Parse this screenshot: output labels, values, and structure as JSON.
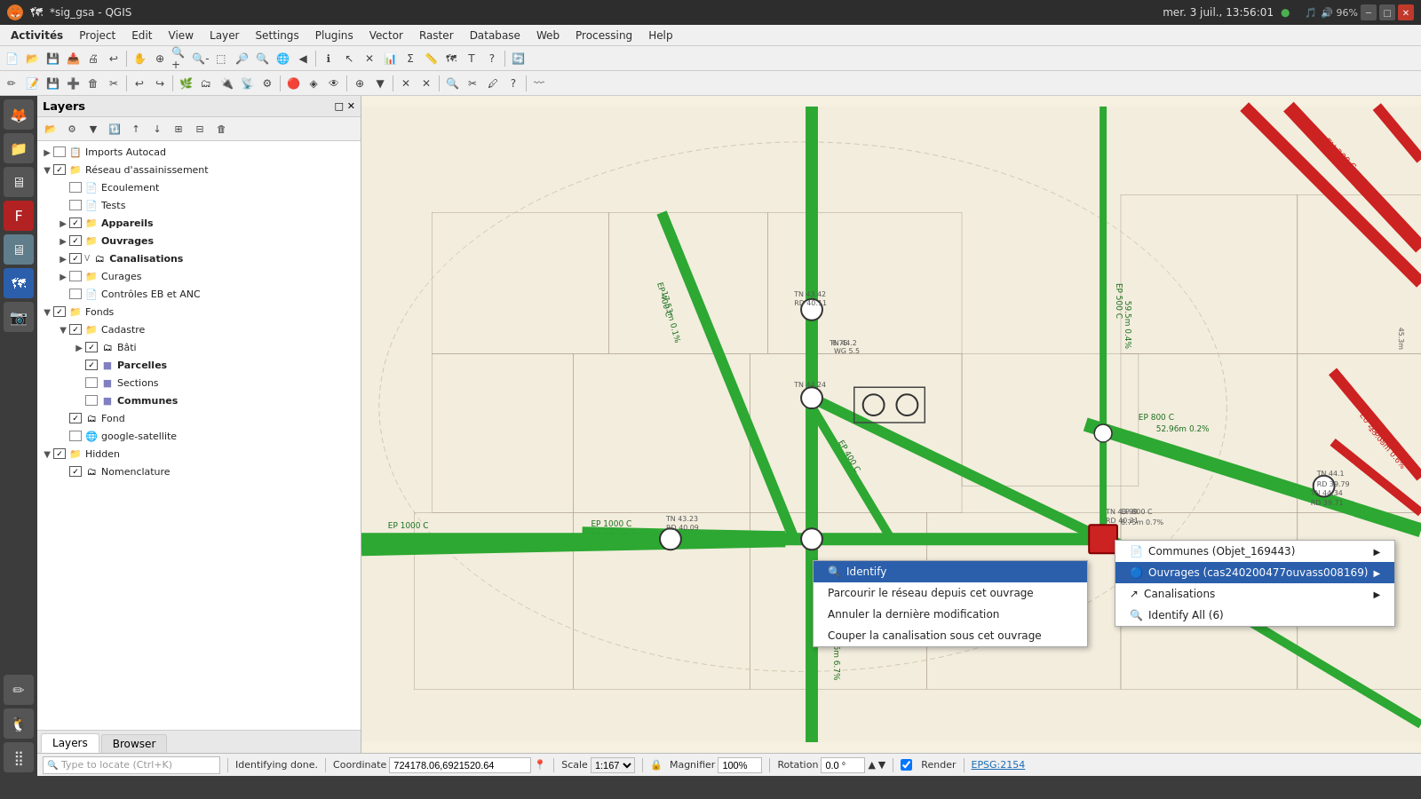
{
  "titlebar": {
    "title": "*sig_gsa - QGIS",
    "datetime": "mer. 3 juil., 13:56:01",
    "dot_indicator": "●",
    "wm_min": "─",
    "wm_max": "□",
    "wm_close": "✕"
  },
  "menubar": {
    "items": [
      "Activités",
      "Project",
      "Edit",
      "View",
      "Layer",
      "Settings",
      "Plugins",
      "Vector",
      "Raster",
      "Database",
      "Web",
      "Processing",
      "Help"
    ]
  },
  "layers_panel": {
    "title": "Layers",
    "tree": [
      {
        "id": "imports-autocad",
        "label": "Imports Autocad",
        "indent": 0,
        "checked": false,
        "has_arrow": true,
        "icon": "📋",
        "bold": false
      },
      {
        "id": "reseau-assainissement",
        "label": "Réseau d'assainissement",
        "indent": 0,
        "checked": true,
        "has_arrow": true,
        "icon": "📁",
        "bold": false
      },
      {
        "id": "ecoulement",
        "label": "Ecoulement",
        "indent": 1,
        "checked": false,
        "has_arrow": false,
        "icon": "📄",
        "bold": false
      },
      {
        "id": "tests",
        "label": "Tests",
        "indent": 1,
        "checked": false,
        "has_arrow": false,
        "icon": "📄",
        "bold": false
      },
      {
        "id": "appareils",
        "label": "Appareils",
        "indent": 1,
        "checked": true,
        "has_arrow": true,
        "icon": "📁",
        "bold": true
      },
      {
        "id": "ouvrages",
        "label": "Ouvrages",
        "indent": 1,
        "checked": true,
        "has_arrow": true,
        "icon": "📁",
        "bold": true
      },
      {
        "id": "canalisations",
        "label": "Canalisations",
        "indent": 1,
        "checked": true,
        "has_arrow": true,
        "icon": "🗂",
        "bold": true
      },
      {
        "id": "curages",
        "label": "Curages",
        "indent": 1,
        "checked": false,
        "has_arrow": true,
        "icon": "📁",
        "bold": false
      },
      {
        "id": "controles-eb-anc",
        "label": "Contrôles EB et ANC",
        "indent": 1,
        "checked": false,
        "has_arrow": false,
        "icon": "📄",
        "bold": false
      },
      {
        "id": "fonds",
        "label": "Fonds",
        "indent": 0,
        "checked": true,
        "has_arrow": true,
        "icon": "📁",
        "bold": false
      },
      {
        "id": "cadastre",
        "label": "Cadastre",
        "indent": 1,
        "checked": true,
        "has_arrow": true,
        "icon": "📁",
        "bold": false
      },
      {
        "id": "bati",
        "label": "Bâti",
        "indent": 2,
        "checked": true,
        "has_arrow": true,
        "icon": "🗂",
        "bold": false
      },
      {
        "id": "parcelles",
        "label": "Parcelles",
        "indent": 2,
        "checked": true,
        "has_arrow": false,
        "icon": "🟦",
        "bold": true
      },
      {
        "id": "sections",
        "label": "Sections",
        "indent": 2,
        "checked": false,
        "has_arrow": false,
        "icon": "🟦",
        "bold": false
      },
      {
        "id": "communes",
        "label": "Communes",
        "indent": 2,
        "checked": false,
        "has_arrow": false,
        "icon": "🟦",
        "bold": true
      },
      {
        "id": "fond",
        "label": "Fond",
        "indent": 1,
        "checked": true,
        "has_arrow": false,
        "icon": "🗂",
        "bold": false
      },
      {
        "id": "google-satellite",
        "label": "google-satellite",
        "indent": 1,
        "checked": false,
        "has_arrow": false,
        "icon": "🌐",
        "bold": false
      },
      {
        "id": "hidden",
        "label": "Hidden",
        "indent": 0,
        "checked": true,
        "has_arrow": true,
        "icon": "📁",
        "bold": false
      },
      {
        "id": "nomenclature",
        "label": "Nomenclature",
        "indent": 1,
        "checked": true,
        "has_arrow": false,
        "icon": "🗂",
        "bold": false
      }
    ]
  },
  "bottom_tabs": {
    "tabs": [
      "Layers",
      "Browser"
    ],
    "active": "Layers"
  },
  "context_menu_main": {
    "items": [
      {
        "label": "Identify",
        "icon": "🔍",
        "highlighted": true
      },
      {
        "label": "Parcourir le réseau depuis cet ouvrage",
        "icon": "",
        "highlighted": false
      },
      {
        "label": "Annuler la dernière modification",
        "icon": "",
        "highlighted": false
      },
      {
        "label": "Couper la canalisation sous cet ouvrage",
        "icon": "",
        "highlighted": false
      }
    ]
  },
  "context_menu_sub": {
    "items": [
      {
        "label": "Communes (Objet_169443)",
        "icon": "📄",
        "highlighted": false,
        "has_arrow": true
      },
      {
        "label": "Ouvrages (cas240200477ouvass008169)",
        "icon": "🔵",
        "highlighted": true,
        "has_arrow": true
      },
      {
        "label": "Canalisations",
        "icon": "↗",
        "highlighted": false,
        "has_arrow": true
      },
      {
        "label": "Identify All (6)",
        "icon": "🔍",
        "highlighted": false,
        "has_arrow": false
      }
    ]
  },
  "statusbar": {
    "status_text": "Identifying done.",
    "coordinate_label": "Coordinate",
    "coordinate_value": "724178.06,6921520.64",
    "scale_label": "Scale",
    "scale_value": "1:167",
    "magnifier_label": "Magnifier",
    "magnifier_value": "100%",
    "rotation_label": "Rotation",
    "rotation_value": "0.0 °",
    "render_label": "Render",
    "epsg_label": "EPSG:2154",
    "locate_placeholder": "Type to locate (Ctrl+K)"
  },
  "icons": {
    "identify": "🔍",
    "arrow_right": "▶",
    "checkmark": "✓",
    "layers": "≡"
  }
}
